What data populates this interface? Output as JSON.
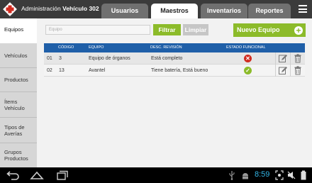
{
  "header": {
    "app_name": "Administración",
    "vehicle_label": "Vehículo 302",
    "tabs": [
      {
        "label": "Usuarios",
        "active": false
      },
      {
        "label": "Maestros",
        "active": true
      },
      {
        "label": "Inventarios",
        "active": false
      },
      {
        "label": "Reportes",
        "active": false
      }
    ],
    "menu_icon": "hamburger-menu-icon"
  },
  "sidebar": {
    "items": [
      {
        "label": "Equipos",
        "active": true
      },
      {
        "label": "Vehículos",
        "active": false
      },
      {
        "label": "Productos",
        "active": false
      },
      {
        "label": "Ítems Vehículo",
        "active": false
      },
      {
        "label": "Tipos de Averías",
        "active": false
      },
      {
        "label": "Grupos Productos",
        "active": false
      }
    ]
  },
  "toolbar": {
    "search_placeholder": "Equipo",
    "filter_label": "Filtrar",
    "clear_label": "Limpiar",
    "new_label": "Nuevo Equipo"
  },
  "table": {
    "columns": [
      "CÓDIGO",
      "EQUIPO",
      "DESC. REVISIÓN",
      "ESTADO FUNCIONAL"
    ],
    "rows": [
      {
        "index": "01",
        "code": "3",
        "equipment": "Equipo de órganos",
        "review": "Está completo",
        "status": "error"
      },
      {
        "index": "02",
        "code": "13",
        "equipment": "Avantel",
        "review": "Tiene batería, Está bueno",
        "status": "ok"
      }
    ]
  },
  "system_bar": {
    "time": "8:59"
  },
  "colors": {
    "accent_green": "#8cbb2a",
    "header_blue": "#1f5fa8",
    "error_red": "#d12b20",
    "clock_blue": "#33b5e5"
  }
}
